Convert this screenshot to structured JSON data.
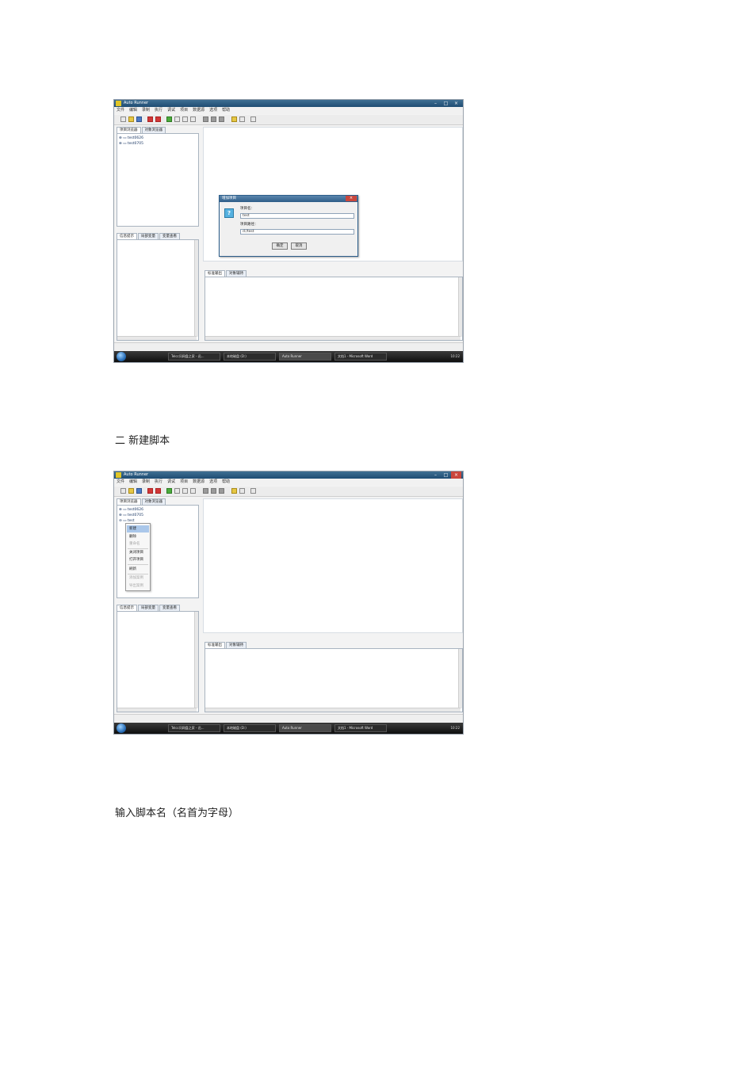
{
  "window": {
    "title": "Auto Runner",
    "menu": [
      "文件",
      "编辑",
      "录制",
      "执行",
      "调试",
      "项目",
      "数据源",
      "选项",
      "帮助"
    ],
    "tabs_top": [
      "项目浏览器",
      "对象浏览器"
    ],
    "tabs_left_bottom": [
      "信息提示",
      "局部变量",
      "变量查看"
    ],
    "tabs_right_bottom": [
      "标准输出",
      "对象辅持"
    ],
    "tree_items": [
      "test0626",
      "test0705"
    ],
    "new_node": "test",
    "taskbar_items": [
      "Telcc问网盘之家 - 迅...",
      "本地磁盘 (D:)",
      "Auto Runner",
      "文档1 - Microsoft Word"
    ],
    "clock": "10:22"
  },
  "dialog": {
    "title": "增加项目",
    "name_label": "项目名：",
    "name_value": "test",
    "path_label": "项目路径：",
    "path_value": "d:/test",
    "ok_label": "确定",
    "cancel_label": "取消"
  },
  "context_menu": {
    "items": [
      "新建",
      "删除",
      "重命名",
      "关闭项目",
      "打开项目",
      "刷新",
      "添加案例",
      "导出案例"
    ]
  },
  "text": {
    "heading_2": "二  新建脚本",
    "caption_3": "输入脚本名（名首为字母）"
  }
}
